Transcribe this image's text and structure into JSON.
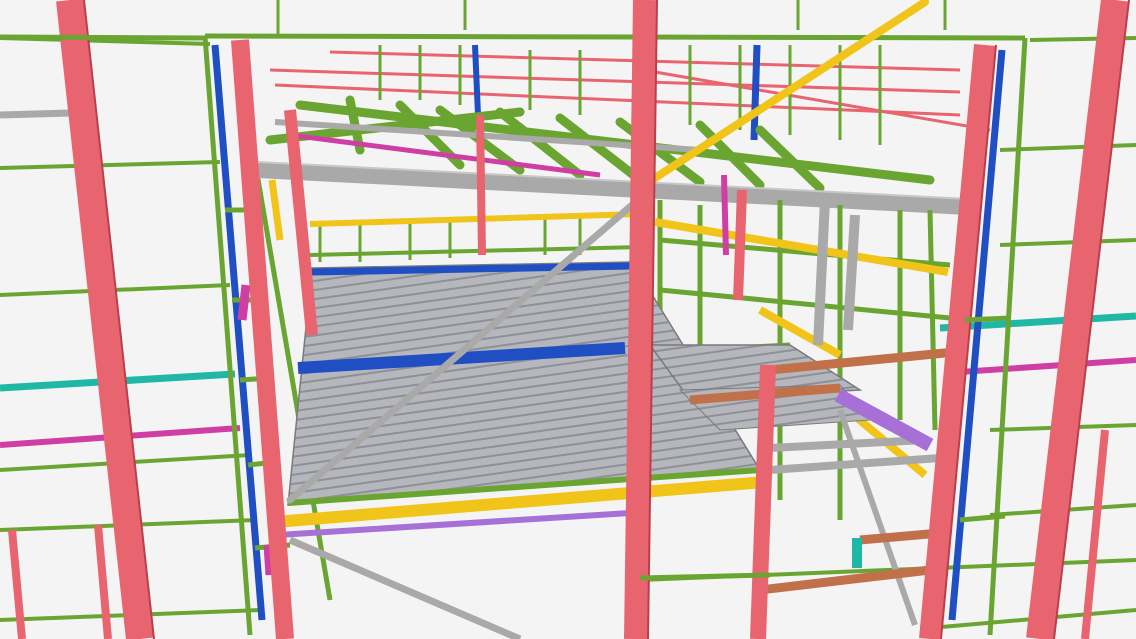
{
  "colors": {
    "background": "#f4f4f4",
    "column": "#e8646f",
    "column_edge": "#b8404c",
    "girt": "#6aa532",
    "girt_edge": "#3f7a18",
    "brace": "#a9a9a9",
    "brace_edge": "#7a7a7a",
    "yellow_beam": "#f0c419",
    "blue_beam": "#1f4fc2",
    "magenta_beam": "#cf3ea5",
    "cyan_beam": "#1fb8a6",
    "orange_beam": "#c0714a",
    "violet_beam": "#a670d6",
    "deck": "#b6b7bd",
    "deck_rib": "#8e9098"
  }
}
